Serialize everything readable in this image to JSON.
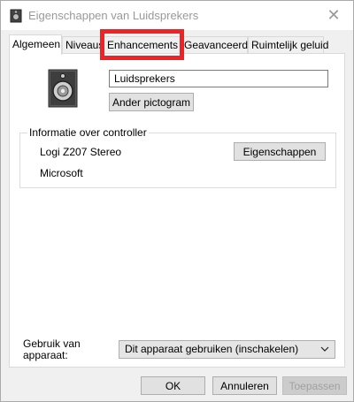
{
  "window": {
    "title": "Eigenschappen van Luidsprekers",
    "close_symbol": "✕"
  },
  "tabs": [
    {
      "label": "Algemeen",
      "active": true
    },
    {
      "label": "Niveaus"
    },
    {
      "label": "Enhancements",
      "highlighted": true
    },
    {
      "label": "Geavanceerd"
    },
    {
      "label": "Ruimtelijk geluid"
    }
  ],
  "device": {
    "icon": "speaker-icon",
    "name": "Luidsprekers",
    "change_icon_label": "Ander pictogram"
  },
  "controller": {
    "group_label": "Informatie over controller",
    "name": "Logi Z207 Stereo",
    "vendor": "Microsoft",
    "properties_label": "Eigenschappen"
  },
  "usage": {
    "label_line1": "Gebruik van",
    "label_line2": "apparaat:",
    "selected": "Dit apparaat gebruiken (inschakelen)"
  },
  "footer": {
    "ok_label": "OK",
    "cancel_label": "Annuleren",
    "apply_label": "Toepassen"
  },
  "colors": {
    "highlight": "#e8262a",
    "window_bg": "#f0f0f0"
  }
}
